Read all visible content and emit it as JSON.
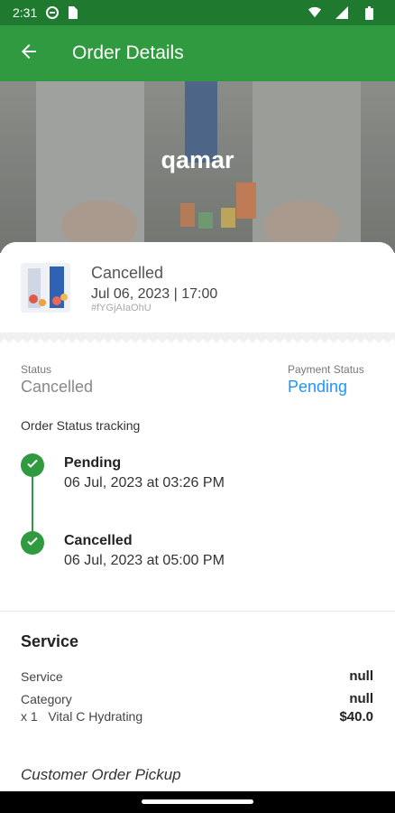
{
  "status_bar": {
    "time": "2:31",
    "icons": [
      "vpn-icon",
      "sim-icon",
      "wifi-icon",
      "signal-icon",
      "battery-icon"
    ]
  },
  "app_bar": {
    "title": "Order Details",
    "back_icon": "arrow-left-icon"
  },
  "hero": {
    "customer_name": "qamar"
  },
  "order": {
    "status": "Cancelled",
    "datetime": "Jul 06, 2023 | 17:00",
    "order_id": "#fYGjAIaOhU"
  },
  "summary": {
    "status_label": "Status",
    "status_value": "Cancelled",
    "payment_label": "Payment Status",
    "payment_value": "Pending",
    "tracking_label": "Order Status tracking"
  },
  "timeline": [
    {
      "title": "Pending",
      "time": "06 Jul, 2023 at 03:26 PM"
    },
    {
      "title": "Cancelled",
      "time": "06 Jul, 2023 at 05:00 PM"
    }
  ],
  "service": {
    "heading": "Service",
    "rows": [
      {
        "label": "Service",
        "value": "null"
      },
      {
        "label": "Category",
        "value": "null"
      },
      {
        "label": "x 1   Vital C Hydrating",
        "value": "$40.0"
      }
    ]
  },
  "pickup": {
    "label": "Customer Order Pickup"
  },
  "colors": {
    "primary": "#2f9a3f",
    "primary_dark": "#1f7a30",
    "link_blue": "#2196f3",
    "muted_gray": "#888888"
  }
}
